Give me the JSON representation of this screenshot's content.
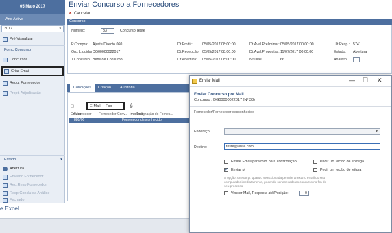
{
  "sidebar": {
    "date": "05 Maio 2017",
    "subtitle": "Ano Activo",
    "year": "2017",
    "items": [
      {
        "label": "Pré-Visualizar"
      },
      {
        "label": "Fornc Concurso"
      },
      {
        "label": "Concursos"
      },
      {
        "label": "Criar Email"
      },
      {
        "label": "Requ. Fornecedor"
      },
      {
        "label": "Propt. Adjudicação"
      }
    ],
    "bottom_section": "Estado",
    "bottom_items": [
      {
        "label": "Abertura"
      },
      {
        "label": "Enviado Fornecedor"
      },
      {
        "label": "Reg.Resp.Fornecedor"
      },
      {
        "label": "Resp.Concluída Análise"
      },
      {
        "label": "Fechado"
      }
    ]
  },
  "header": {
    "title": "Enviar Concurso a Fornecedores",
    "cancel": "Cancelar"
  },
  "concurso": {
    "bar_label": "Concurso",
    "numero_label": "Número:",
    "numero_value": "33",
    "descricao": "Concurso Teste",
    "fields": [
      {
        "label": "P.Compra:",
        "value": "Ajuste Directo 060"
      },
      {
        "label": "Ord. Liquidar:",
        "value": "DG00000022017"
      },
      {
        "label": "T.Concurso:",
        "value": "Bens de Consumo"
      },
      {
        "label": "Dt.Emitir:",
        "value": "05/05/2017 08:00:00"
      },
      {
        "label": "Dt.Recepção:",
        "value": "05/05/2017 08:00:00"
      },
      {
        "label": "Dt.Abertura:",
        "value": "05/05/2017 08:00:00"
      },
      {
        "label": "Dt.Aval.Preliminar:",
        "value": "05/05/2017 00:00:00"
      },
      {
        "label": "Dt.Aval.Propostas:",
        "value": "11/07/2017 00:00:00"
      },
      {
        "label": "Nº Dias:",
        "value": "66"
      },
      {
        "label": "Ult.Resp.:",
        "value": "5741"
      },
      {
        "label": "Estado:",
        "value": "Abertura"
      },
      {
        "label": "Analisto:",
        "value": ""
      }
    ]
  },
  "tabs": [
    {
      "label": "Condições"
    },
    {
      "label": "Criação"
    },
    {
      "label": "Auditoria"
    }
  ],
  "table": {
    "toolbar": {
      "enviar": "Enviar",
      "email": "E-Mail",
      "fax": "Fax",
      "imprimir": "Imprimir"
    },
    "columns": [
      "Fornecedor",
      "Fornecedor Conv...",
      "Designação do Fornec..."
    ],
    "row": {
      "id": "888/00",
      "value": "Fornecedor desconhecido"
    }
  },
  "dialog": {
    "title": "Enviar Mail",
    "heading": "Enviar Concurso por Mail",
    "subheading": "Concurso : DG00000022017 (Nº 33)",
    "note": "Fornecedor/Fornecedor desconhecido",
    "endereco_label": "Endereço:",
    "destino_label": "Destino:",
    "destino_value": "teste@teste.com",
    "options": [
      {
        "label": "Enviar Email para mim para confirmação",
        "checked": false
      },
      {
        "label": "Pedir um recibo de entrega",
        "checked": false
      },
      {
        "label": "Enviar pt",
        "checked": true
      },
      {
        "label": "Pedir um recibo de leitura",
        "checked": false
      }
    ],
    "info": "A opção 'Anexar pt' quando seleccionada permite anexar o email do seu computador imediatamente, podendo ser anexado ao concurso no fim do seu processo",
    "venc_label": "Vencer Mail, Resposta até/Posição:",
    "venc_value": "0"
  },
  "bottom": {
    "label": "e Excel"
  }
}
